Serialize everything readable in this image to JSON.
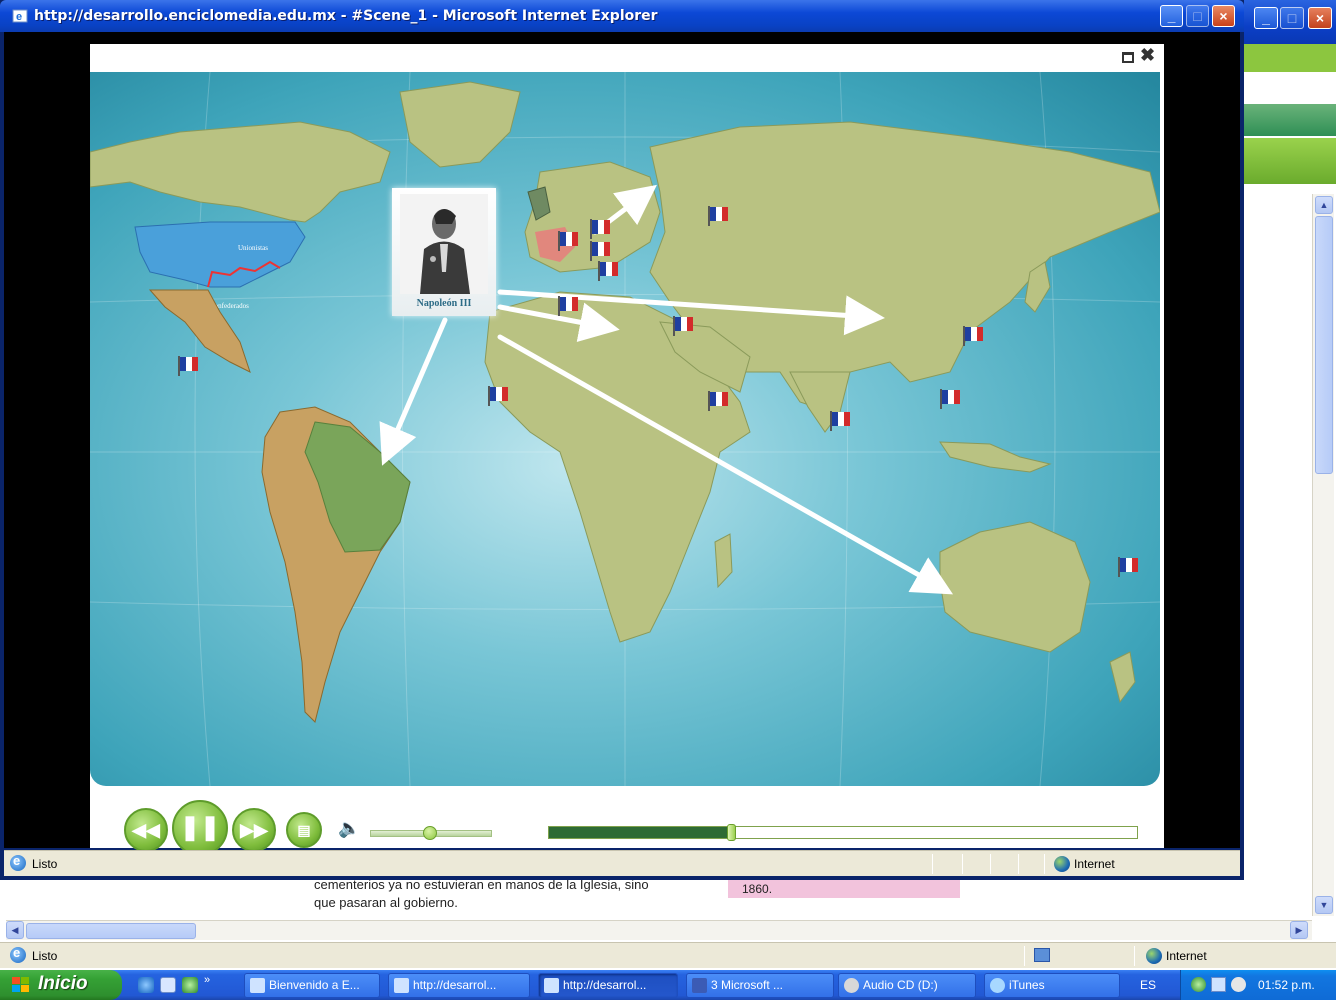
{
  "window": {
    "title": "http://desarrollo.enciclomedia.edu.mx - #Scene_1 - Microsoft Internet Explorer",
    "status_text": "Listo",
    "zone": "Internet"
  },
  "background_window": {
    "text_lines": [
      "cementerios ya no estuvieran en manos de la Iglesia, sino",
      "que pasaran al gobierno."
    ],
    "pink_cell": "1860.",
    "status_text": "Listo",
    "zone": "Internet"
  },
  "map": {
    "portrait_caption": "Napoleón III",
    "us_labels": [
      "Unionistas",
      "Confederados"
    ]
  },
  "player": {
    "volume_level": 0.5,
    "progress": 0.31
  },
  "taskbar": {
    "start_label": "Inicio",
    "tasks": [
      "Bienvenido a E...",
      "http://desarrol...",
      "http://desarrol...",
      "3 Microsoft ...",
      "Audio CD (D:)",
      "iTunes"
    ],
    "language": "ES",
    "clock": "01:52 p.m."
  },
  "colors": {
    "xp_blue": "#0c48d6",
    "ocean": "#3ea4ba",
    "land": "#b9c282",
    "control_green": "#7fbd3c"
  }
}
